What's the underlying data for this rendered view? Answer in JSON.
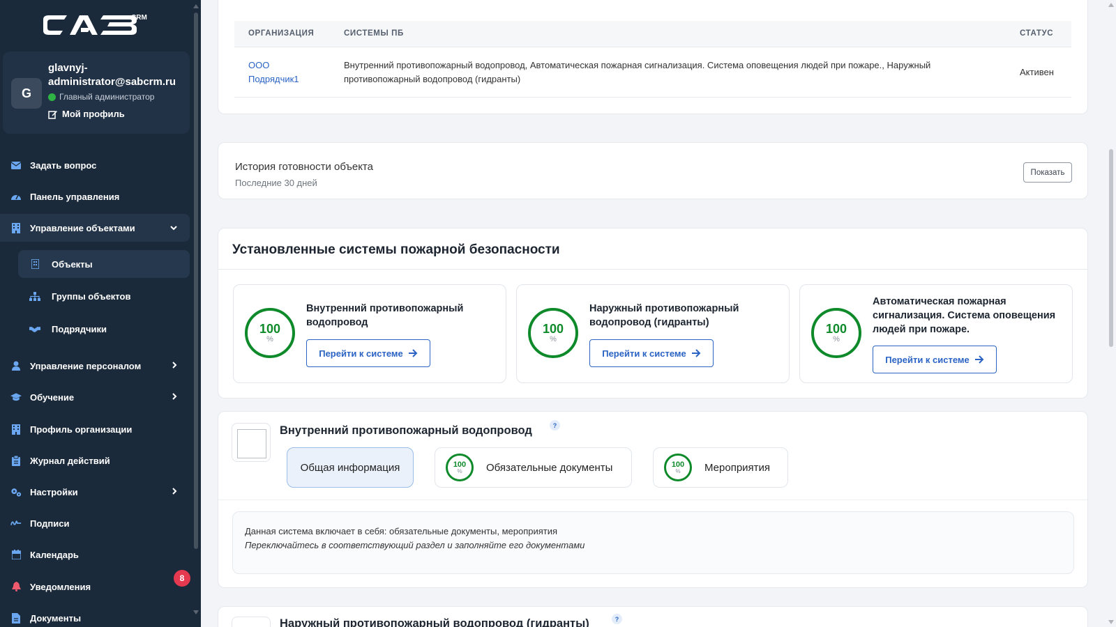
{
  "sidebar": {
    "logo": "CAB",
    "logo_sub": "CRM",
    "user": {
      "initial": "G",
      "name": "glavnyj-administrator@sabcrm.ru",
      "role": "Главный администратор",
      "profile_link": "Мой профиль"
    },
    "nav": [
      {
        "label": "Задать вопрос",
        "icon": "envelope-icon"
      },
      {
        "label": "Панель управления",
        "icon": "gauge-icon"
      },
      {
        "label": "Управление объектами",
        "icon": "building-icon"
      },
      {
        "label": "Объекты",
        "icon": "building-icon"
      },
      {
        "label": "Группы объектов",
        "icon": "sitemap-icon"
      },
      {
        "label": "Подрядчики",
        "icon": "handshake-icon"
      },
      {
        "label": "Управление персоналом",
        "icon": "user-icon"
      },
      {
        "label": "Обучение",
        "icon": "graduation-cap-icon"
      },
      {
        "label": "Профиль организации",
        "icon": "building-icon"
      },
      {
        "label": "Журнал действий",
        "icon": "clipboard-icon"
      },
      {
        "label": "Настройки",
        "icon": "gears-icon"
      },
      {
        "label": "Подписи",
        "icon": "signature-icon"
      },
      {
        "label": "Календарь",
        "icon": "calendar-icon"
      },
      {
        "label": "Уведомления",
        "icon": "bell-icon"
      },
      {
        "label": "Документы",
        "icon": "file-icon"
      }
    ],
    "notifications_count": "8"
  },
  "contractors_table": {
    "headers": [
      "ОРГАНИЗАЦИЯ",
      "СИСТЕМЫ ПБ",
      "СТАТУС"
    ],
    "rows": [
      {
        "organization": "ООО Подрядчик1",
        "systems": "Внутренний противопожарный водопровод, Автоматическая пожарная сигнализация. Система оповещения людей при пожаре., Наружный противопожарный водопровод (гидранты)",
        "status": "Активен"
      }
    ]
  },
  "history": {
    "title": "История готовности объекта",
    "subtitle": "Последние 30 дней",
    "show_button": "Показать"
  },
  "installed_systems": {
    "title": "Установленные системы пожарной безопасности",
    "percent_sign": "%",
    "go_button": "Перейти к системе",
    "cards": [
      {
        "title": "Внутренний противопожарный водопровод",
        "value": "100"
      },
      {
        "title": "Наружный противопожарный водопровод (гидранты)",
        "value": "100"
      },
      {
        "title": "Автоматическая пожарная сигнализация. Система оповещения людей при пожаре.",
        "value": "100"
      }
    ]
  },
  "system_detail": {
    "title": "Внутренний противопожарный водопровод",
    "help": "?",
    "tabs": [
      {
        "label": "Общая информация"
      },
      {
        "label": "Обязательные документы",
        "value": "100"
      },
      {
        "label": "Мероприятия",
        "value": "100"
      }
    ],
    "info_line1": "Данная система включает в себя: обязательные документы, мероприятия",
    "info_line2": "Переключайтесь в соответствующий раздел и заполняйте его документами"
  },
  "next_system": {
    "title": "Наружный противопожарный водопровод (гидранты)",
    "help": "?"
  }
}
